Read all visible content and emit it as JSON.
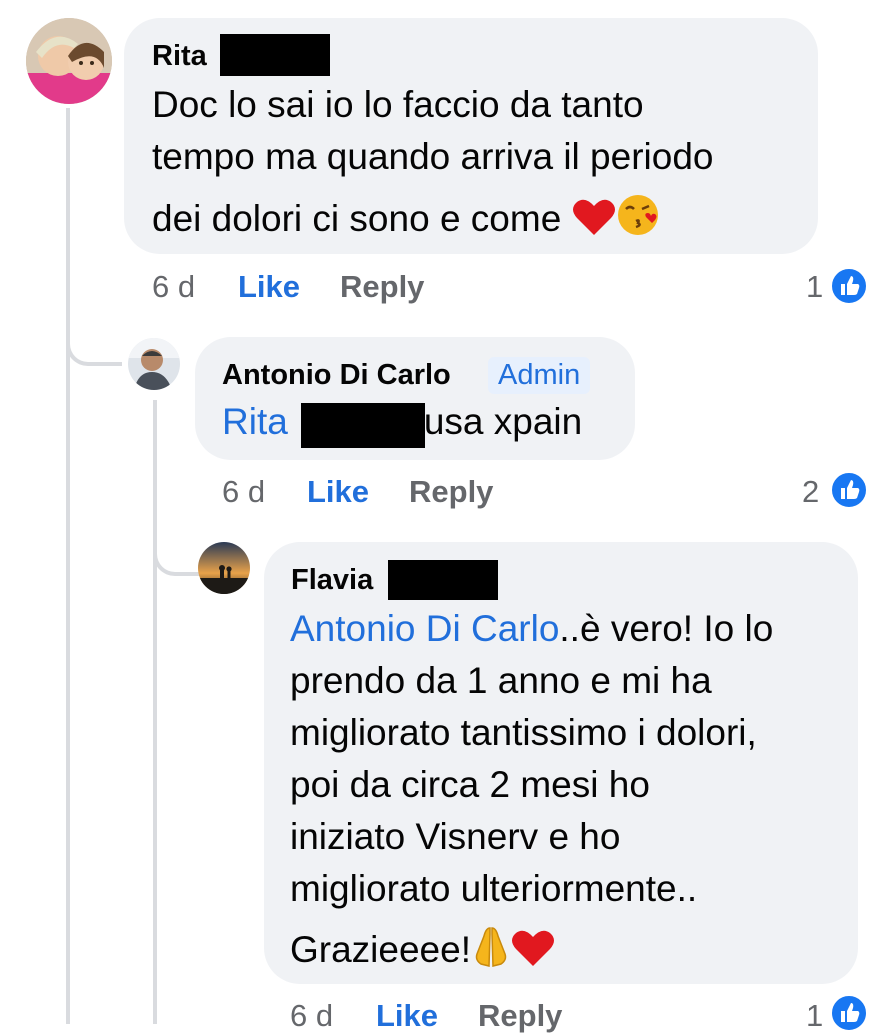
{
  "comments": [
    {
      "author": "Rita",
      "lines": [
        "Doc lo sai io lo faccio da tanto",
        "tempo ma quando arriva il periodo",
        "dei dolori ci sono e come"
      ],
      "time": "6 d",
      "like": "Like",
      "reply": "Reply",
      "reactions": "1"
    },
    {
      "author": "Antonio Di Carlo",
      "badge": "Admin",
      "mention": "Rita",
      "text": "usa xpain",
      "time": "6 d",
      "like": "Like",
      "reply": "Reply",
      "reactions": "2"
    },
    {
      "author": "Flavia",
      "mention": "Antonio Di Carlo",
      "first_line_rest": "..è vero! Io lo",
      "lines": [
        "prendo da 1 anno e mi ha",
        "migliorato tantissimo i dolori,",
        "poi da circa 2 mesi ho",
        "iniziato Visnerv e ho",
        "migliorato ulteriormente..",
        "Grazieeee!"
      ],
      "time": "6 d",
      "like": "Like",
      "reply": "Reply",
      "reactions": "1"
    }
  ],
  "colors": {
    "link": "#216fdb",
    "bubble": "#f0f2f5",
    "like_badge": "#1877f2",
    "muted": "#65676b"
  },
  "icons": {
    "reaction": "thumbs-up-icon",
    "emoji_heart": "red-heart-emoji",
    "emoji_kiss": "face-blowing-kiss-emoji",
    "emoji_pray": "folded-hands-emoji"
  }
}
